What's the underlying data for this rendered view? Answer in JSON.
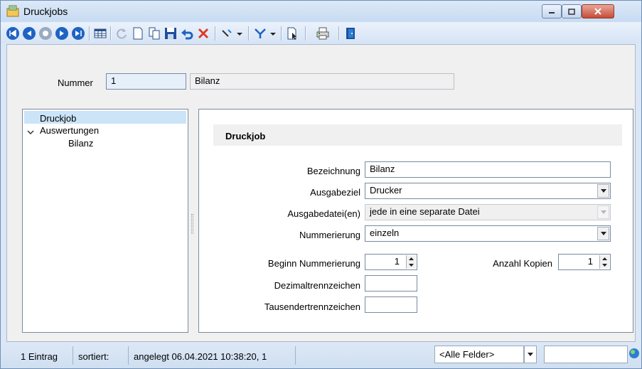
{
  "window": {
    "title": "Druckjobs"
  },
  "toolbar": {
    "icons": [
      "first-record-icon",
      "previous-record-icon",
      "center-icon",
      "next-record-icon",
      "last-record-icon",
      "table-view-icon",
      "refresh-icon",
      "new-record-icon",
      "copy-record-icon",
      "save-icon",
      "undo-icon",
      "delete-icon",
      "tools-icon",
      "filter-icon",
      "document-select-icon",
      "print-icon",
      "exit-door-icon"
    ]
  },
  "header": {
    "number_label": "Nummer",
    "number_value": "1",
    "name_value": "Bilanz"
  },
  "tree": {
    "items": [
      {
        "label": "Druckjob"
      },
      {
        "label": "Auswertungen"
      },
      {
        "label": "Bilanz"
      }
    ]
  },
  "form": {
    "section_title": "Druckjob",
    "bezeichnung_label": "Bezeichnung",
    "bezeichnung_value": "Bilanz",
    "ausgabeziel_label": "Ausgabeziel",
    "ausgabeziel_value": "Drucker",
    "ausgabedatei_label": "Ausgabedatei(en)",
    "ausgabedatei_value": "jede in eine separate Datei",
    "nummerierung_label": "Nummerierung",
    "nummerierung_value": "einzeln",
    "beginn_label": "Beginn Nummerierung",
    "beginn_value": "1",
    "kopien_label": "Anzahl Kopien",
    "kopien_value": "1",
    "dezimal_label": "Dezimaltrennzeichen",
    "dezimal_value": "",
    "tausender_label": "Tausendertrennzeichen",
    "tausender_value": ""
  },
  "status": {
    "count": "1 Eintrag",
    "sorted_label": "sortiert:",
    "created": "angelegt 06.04.2021 10:38:20,  1",
    "field_filter": "<Alle Felder>"
  },
  "colors": {
    "nav_blue": "#1e63c4",
    "delete_red": "#e03a2a",
    "selection": "#cce4f7"
  }
}
